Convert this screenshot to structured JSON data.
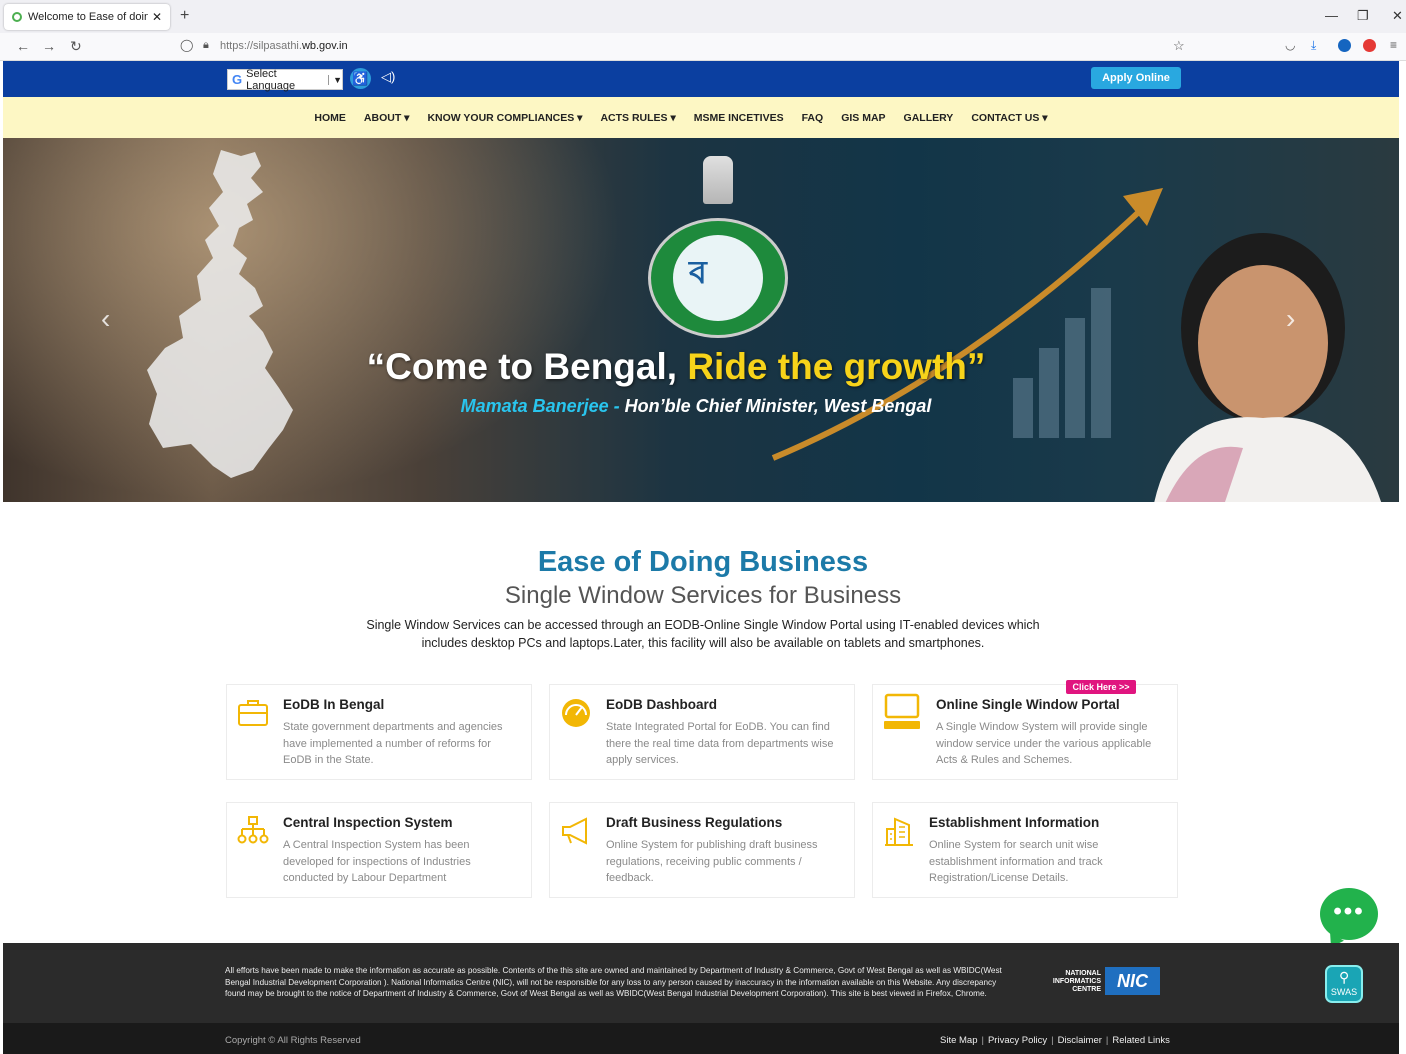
{
  "browser": {
    "tab_title": "Welcome to Ease of doing busi",
    "url_prefix": "https://silpasathi.",
    "url_domain": "wb.gov.in"
  },
  "topbar": {
    "language_label": "Select Language",
    "apply_label": "Apply Online"
  },
  "menu": [
    "HOME",
    "ABOUT ▾",
    "KNOW YOUR COMPLIANCES ▾",
    "ACTS RULES ▾",
    "MSME INCETIVES",
    "FAQ",
    "GIS MAP",
    "GALLERY",
    "CONTACT US ▾"
  ],
  "hero": {
    "quote_open": "“",
    "quote_white": "Come to Bengal, ",
    "quote_gold": "Ride the growth",
    "quote_close": "”",
    "name": "Mamata Banerjee - ",
    "role": "Hon’ble Chief Minister, West Bengal",
    "seal_letter": "ব"
  },
  "intro": {
    "title": "Ease of Doing Business",
    "subtitle": "Single Window Services for Business",
    "text": "Single Window Services can be accessed through an EODB-Online Single Window Portal using IT-enabled devices which includes desktop PCs and laptops.Later, this facility will also be available on tablets and smartphones."
  },
  "cards": [
    {
      "title": "EoDB In Bengal",
      "text": "State government departments and agencies have implemented a number of reforms for EoDB in the State.",
      "icon": "briefcase-icon"
    },
    {
      "title": "EoDB Dashboard",
      "text": "State Integrated Portal for EoDB. You can find there the real time data from departments wise apply services.",
      "icon": "speedometer-icon"
    },
    {
      "title": "Online Single Window Portal",
      "text": "A Single Window System will provide single window service under the various applicable Acts & Rules and Schemes.",
      "icon": "computer-icon"
    },
    {
      "title": "Central Inspection System",
      "text": "A Central Inspection System has been developed for inspections of Industries conducted by Labour Department",
      "icon": "sitemap-icon"
    },
    {
      "title": "Draft Business Regulations",
      "text": "Online System for publishing draft business regulations, receiving public comments / feedback.",
      "icon": "megaphone-icon"
    },
    {
      "title": "Establishment Information",
      "text": "Online System for search unit wise establishment information and track Registration/License Details.",
      "icon": "building-icon"
    }
  ],
  "click_here": "Click Here >>",
  "chat_dots": "•••",
  "footer": {
    "disclaimer": "All efforts have been made to make the information as accurate as possible. Contents of the this site are owned and maintained by Department of Industry & Commerce, Govt of West Bengal as well as WBIDC(West Bengal Industrial Development Corporation ). National Informatics Centre (NIC), will not be responsible for any loss to any person caused by inaccuracy in the information available on this Website. Any discrepancy found may be brought to the notice of Department of Industry & Commerce, Govt of West Bengal as well as WBIDC(West Bengal Industrial Development Corporation). This site is best viewed in Firefox, Chrome.",
    "nic_label": "NATIONAL INFORMATICS CENTRE",
    "nic_logo": "NIC",
    "swas": "SWAS",
    "copyright": "Copyright © All Rights Reserved",
    "links": [
      "Site Map",
      "Privacy Policy",
      "Disclaimer",
      "Related Links"
    ]
  },
  "colors": {
    "brand_blue": "#0b3fa0",
    "menu_bg": "#fdf7c4",
    "title_blue": "#1c7aa8",
    "gold": "#f7d31a",
    "icon_gold": "#f2b705"
  }
}
